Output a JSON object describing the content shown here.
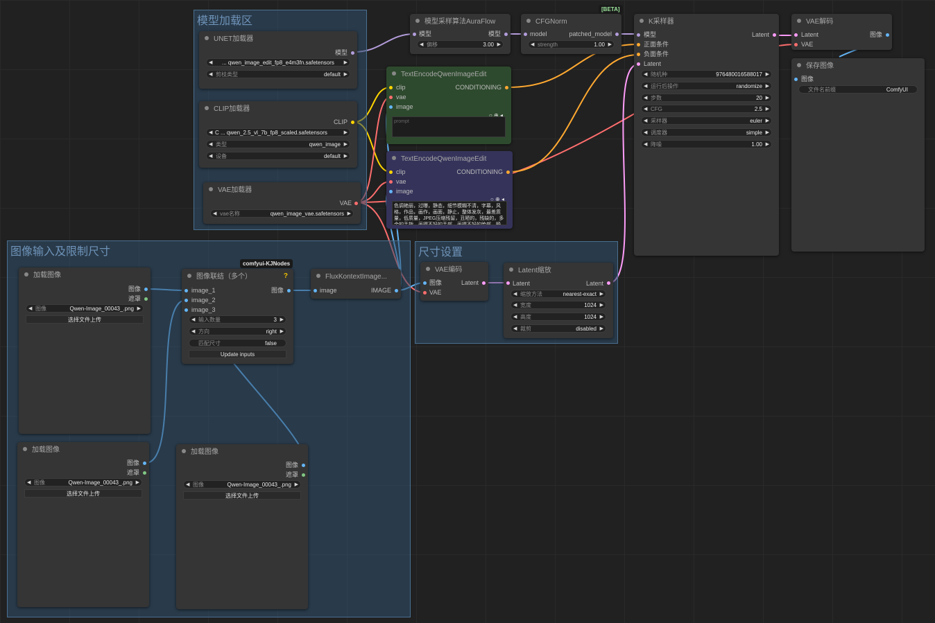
{
  "groups": {
    "model_load": "模型加载区",
    "image_input": "图像输入及限制尺寸",
    "size_settings": "尺寸设置"
  },
  "badges": {
    "beta": "[BETA]",
    "kjnodes": "comfyui-KJNodes",
    "question": "?"
  },
  "nodes": {
    "unet": {
      "title": "UNET加载器",
      "out": "模型",
      "name_value": "... qwen_image_edit_fp8_e4m3fn.safetensors",
      "dtype_label": "剪枝类型",
      "dtype_value": "default"
    },
    "clip": {
      "title": "CLIP加载器",
      "out": "CLIP",
      "name_value": "C ... qwen_2.5_vl_7b_fp8_scaled.safetensors",
      "type_label": "类型",
      "type_value": "qwen_image",
      "device_label": "设备",
      "device_value": "default"
    },
    "vae_loader": {
      "title": "VAE加载器",
      "out": "VAE",
      "name_label": "vae名称",
      "name_value": "qwen_image_vae.safetensors"
    },
    "aura": {
      "title": "模型采样算法AuraFlow",
      "in": "模型",
      "out": "模型",
      "shift_label": "偏移",
      "shift_value": "3.00"
    },
    "cfgnorm": {
      "title": "CFGNorm",
      "in": "model",
      "out": "patched_model",
      "strength_label": "strength",
      "strength_value": "1.00"
    },
    "ksampler": {
      "title": "K采样器",
      "in_model": "模型",
      "in_pos": "正面条件",
      "in_neg": "负面条件",
      "in_latent": "Latent",
      "out": "Latent",
      "widgets": [
        {
          "label": "随机种",
          "value": "976480016588017"
        },
        {
          "label": "运行后操作",
          "value": "randomize"
        },
        {
          "label": "步数",
          "value": "20"
        },
        {
          "label": "CFG",
          "value": "2.5"
        },
        {
          "label": "采样器",
          "value": "euler"
        },
        {
          "label": "调度器",
          "value": "simple"
        },
        {
          "label": "降噪",
          "value": "1.00"
        }
      ]
    },
    "vae_decode": {
      "title": "VAE解码",
      "in_latent": "Latent",
      "in_vae": "VAE",
      "out": "图像"
    },
    "save": {
      "title": "保存图像",
      "in": "图像",
      "prefix_label": "文件名前缀",
      "prefix_value": "ComfyUI"
    },
    "te_pos": {
      "title": "TextEncodeQwenImageEdit",
      "in_clip": "clip",
      "in_vae": "vae",
      "in_image": "image",
      "out": "CONDITIONING",
      "placeholder": "prompt"
    },
    "te_neg": {
      "title": "TextEncodeQwenImageEdit",
      "in_clip": "clip",
      "in_vae": "vae",
      "in_image": "image",
      "out": "CONDITIONING",
      "prompt": "色调艳丽，过曝，静态，细节模糊不清，字幕，风格，作品，画作，画面，静止，整体发灰，最差质量，低质量，JPEG压缩残留，丑陋的，残缺的，多余的手指，画得不好的手部，画得不好的脸部，畸形"
    },
    "load1": {
      "title": "加载图像",
      "out_image": "图像",
      "out_mask": "遮罩",
      "image_label": "图像",
      "image_value": "Qwen-Image_00043_.png",
      "upload": "选择文件上传"
    },
    "load2": {
      "title": "加载图像",
      "out_image": "图像",
      "out_mask": "遮罩",
      "image_label": "图像",
      "image_value": "Qwen-Image_00043_.png",
      "upload": "选择文件上传"
    },
    "load3": {
      "title": "加载图像",
      "out_image": "图像",
      "out_mask": "遮罩",
      "image_label": "图像",
      "image_value": "Qwen-Image_00043_.png",
      "upload": "选择文件上传"
    },
    "concat": {
      "title": "图像联结（多个）",
      "in1": "image_1",
      "in2": "image_2",
      "in3": "image_3",
      "out": "图像",
      "count_label": "输入数量",
      "count_value": "3",
      "dir_label": "方向",
      "dir_value": "right",
      "match_label": "匹配尺寸",
      "match_value": "false",
      "update": "Update inputs"
    },
    "flux": {
      "title": "FluxKontextImage...",
      "in": "image",
      "out": "IMAGE"
    },
    "vae_encode": {
      "title": "VAE编码",
      "in_image": "图像",
      "in_vae": "VAE",
      "out": "Latent"
    },
    "latent_scale": {
      "title": "Latent缩放",
      "in": "Latent",
      "out": "Latent",
      "widgets": [
        {
          "label": "缩放方法",
          "value": "nearest-exact"
        },
        {
          "label": "宽度",
          "value": "1024"
        },
        {
          "label": "高度",
          "value": "1024"
        },
        {
          "label": "裁剪",
          "value": "disabled"
        }
      ]
    }
  },
  "colors": {
    "model": "#b39ddb",
    "clip": "#ffd500",
    "vae": "#ff6e6e",
    "conditioning": "#ffa931",
    "latent": "#ff9cf9",
    "image": "#64b5f6",
    "mask": "#81c784"
  }
}
